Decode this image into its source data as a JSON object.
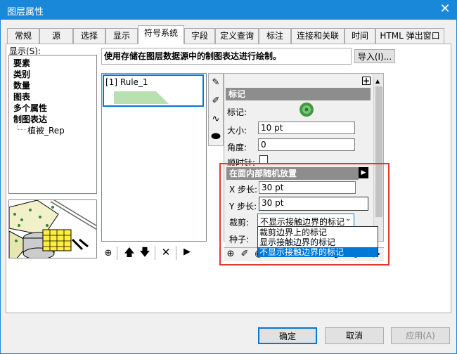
{
  "window": {
    "title": "图层属性",
    "close_glyph": "✕"
  },
  "tabs": [
    "常规",
    "源",
    "选择",
    "显示",
    "符号系统",
    "字段",
    "定义查询",
    "标注",
    "连接和关联",
    "时间",
    "HTML 弹出窗口"
  ],
  "active_tab_index": 4,
  "left": {
    "show_label": "显示(S):",
    "items": [
      "要素",
      "类别",
      "数量",
      "图表",
      "多个属性",
      "制图表达"
    ],
    "subitem": "植被_Rep"
  },
  "header": {
    "description": "使用存储在图层数据源中的制图表达进行绘制。",
    "import_button": "导入(I)..."
  },
  "rules": {
    "rule_label": "[1] Rule_1"
  },
  "marker": {
    "section_title": "标记",
    "marker_label": "标记:",
    "size_label": "大小:",
    "size_value": "10 pt",
    "angle_label": "角度:",
    "angle_value": "0",
    "clockwise_label": "顺时针:",
    "plus_glyph": "+"
  },
  "placement": {
    "section_title": "在面内部随机放置",
    "x_step_label": "X 步长:",
    "x_step_value": "30 pt",
    "y_step_label": "Y 步长:",
    "y_step_value": "30 pt",
    "clip_label": "裁剪:",
    "clip_selected": "不显示接触边界的标记",
    "seed_label": "种子:",
    "clip_options": [
      "裁剪边界上的标记",
      "显示接触边界的标记",
      "不显示接触边界的标记"
    ],
    "highlighted_option_index": 2
  },
  "footer": {
    "ok": "确定",
    "cancel": "取消",
    "apply": "应用(A)"
  },
  "colors": {
    "titlebar": "#1a88d8",
    "highlight": "#0078d7",
    "red_frame": "#e0392b",
    "rule_preview": "#b8e0b0"
  }
}
